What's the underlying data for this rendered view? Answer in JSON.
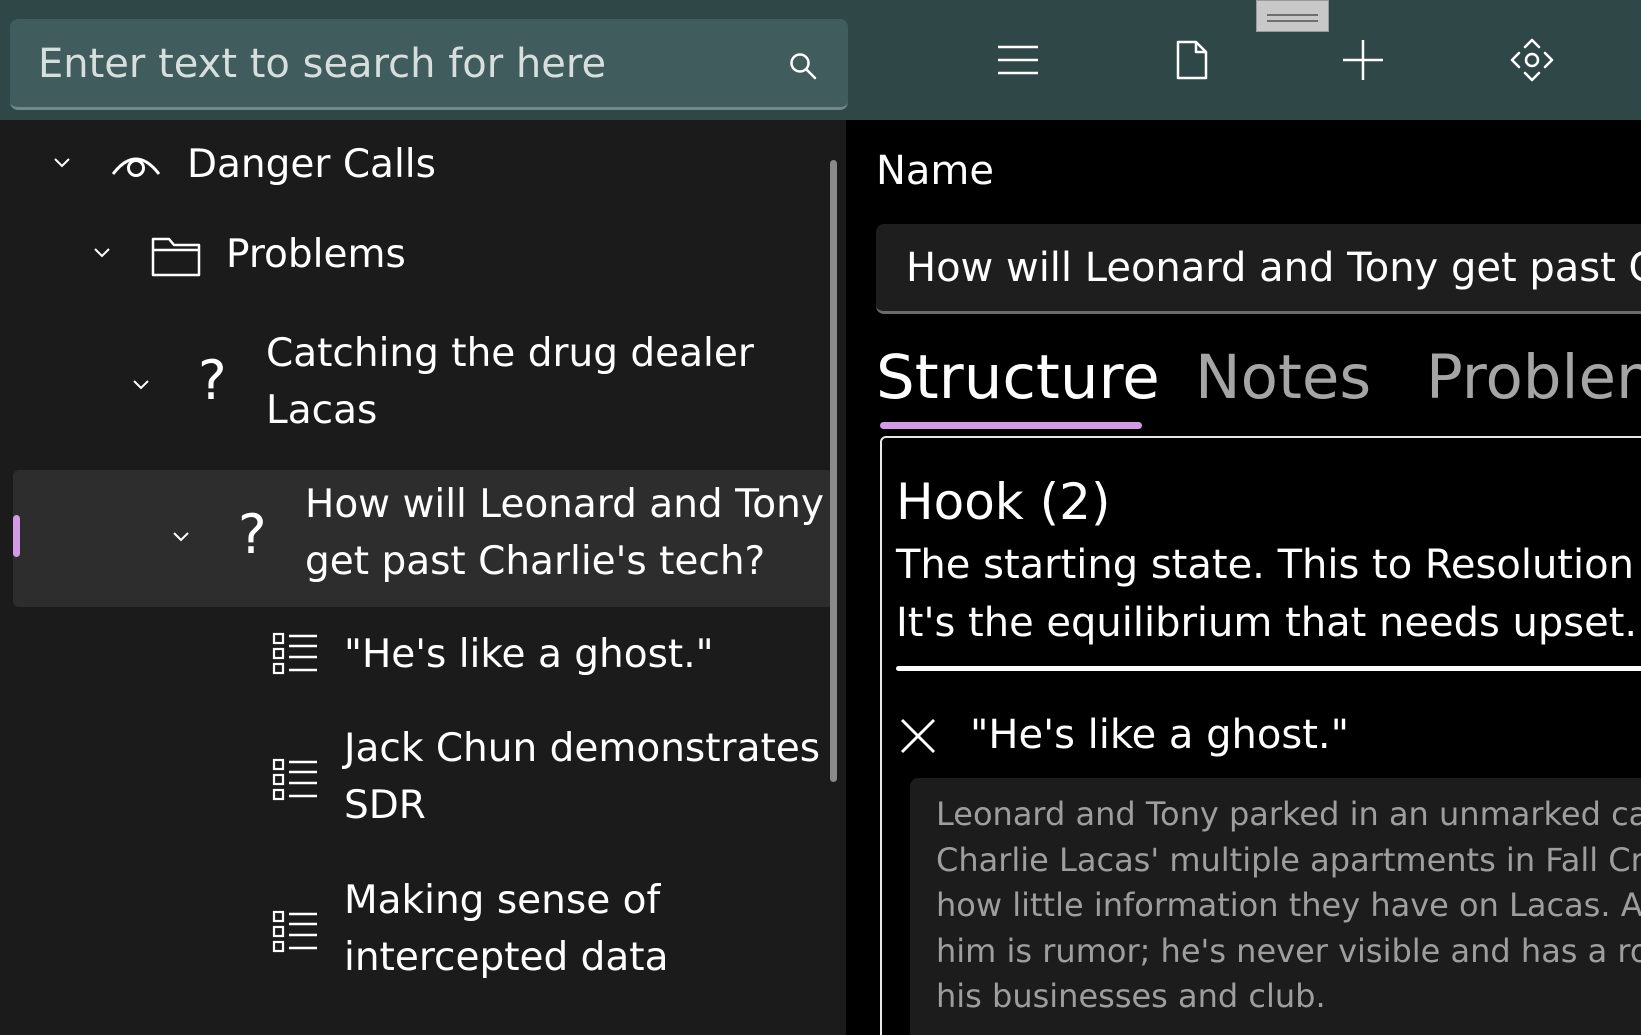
{
  "search": {
    "placeholder": "Enter text to search for here"
  },
  "toolbar": {
    "icons": [
      "menu-icon",
      "document-icon",
      "plus-icon",
      "move-icon"
    ]
  },
  "tree": {
    "items": [
      {
        "label": "Danger Calls",
        "icon": "eye-icon"
      },
      {
        "label": "Problems",
        "icon": "folder-icon"
      },
      {
        "label_lines": [
          "Catching the drug dealer",
          "Lacas"
        ],
        "icon": "question-icon"
      },
      {
        "label_lines": [
          "How will Leonard and Tony",
          "get past Charlie's tech?"
        ],
        "icon": "question-icon",
        "selected": true
      },
      {
        "label": "\"He's like a ghost.\"",
        "icon": "list-icon"
      },
      {
        "label_lines": [
          "Jack Chun demonstrates",
          "SDR"
        ],
        "icon": "list-icon"
      },
      {
        "label_lines": [
          "Making sense of",
          "intercepted data"
        ],
        "icon": "list-icon"
      }
    ]
  },
  "detail": {
    "name_label": "Name",
    "name_value": "How will Leonard and Tony get past Charlie's tech?",
    "tabs": [
      {
        "label": "Structure",
        "active": true
      },
      {
        "label": "Notes",
        "active": false
      },
      {
        "label": "Problems",
        "active": false
      }
    ],
    "card": {
      "title": "Hook (2)",
      "description_lines": [
        "The starting state. This to Resolution fo",
        "It's the equilibrium that needs upset."
      ],
      "beat_title": "\"He's like a ghost.\"",
      "beat_notes": "Leonard and Tony parked in an unmarked ca\nCharlie Lacas' multiple apartments in Fall Cre\nhow little information they have on Lacas. Al\nhim is rumor; he's never visible and has a rou\nhis businesses and club."
    }
  },
  "colors": {
    "accent": "#d39ae6",
    "topbar": "#2f4747",
    "tree_bg": "#1b1b1b",
    "selected_row": "#2d2d2d"
  }
}
